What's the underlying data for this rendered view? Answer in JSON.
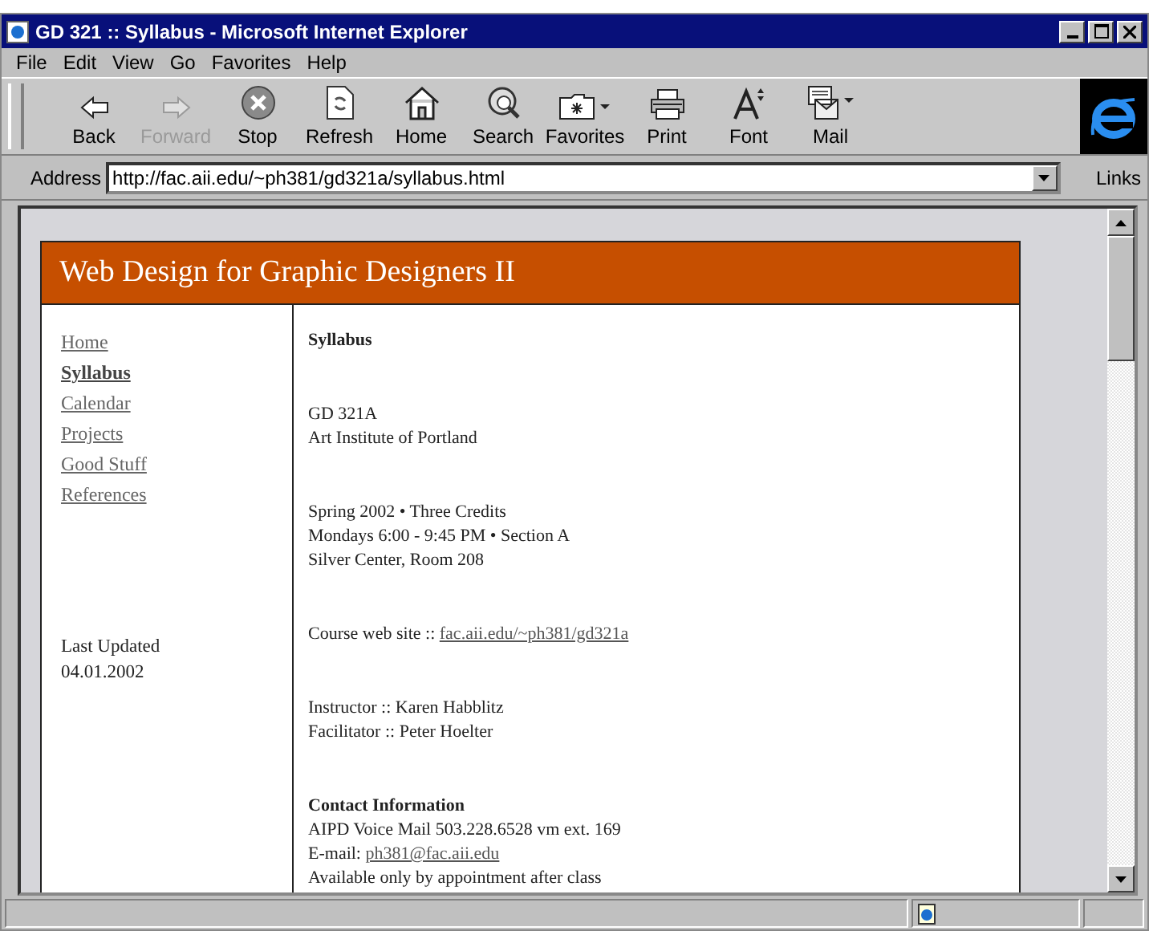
{
  "window": {
    "title": "GD 321 :: Syllabus - Microsoft Internet Explorer"
  },
  "menu": [
    "File",
    "Edit",
    "View",
    "Go",
    "Favorites",
    "Help"
  ],
  "toolbar": [
    {
      "kind": "back",
      "label": "Back",
      "disabled": false
    },
    {
      "kind": "forward",
      "label": "Forward",
      "disabled": true
    },
    {
      "kind": "stop",
      "label": "Stop",
      "disabled": false
    },
    {
      "kind": "refresh",
      "label": "Refresh",
      "disabled": false
    },
    {
      "kind": "home",
      "label": "Home",
      "disabled": false
    },
    {
      "kind": "search",
      "label": "Search",
      "disabled": false
    },
    {
      "kind": "favorites",
      "label": "Favorites",
      "disabled": false
    },
    {
      "kind": "print",
      "label": "Print",
      "disabled": false
    },
    {
      "kind": "font",
      "label": "Font",
      "disabled": false
    },
    {
      "kind": "mail",
      "label": "Mail",
      "disabled": false
    }
  ],
  "address": {
    "label": "Address",
    "value": "http://fac.aii.edu/~ph381/gd321a/syllabus.html"
  },
  "links": "Links",
  "page": {
    "heading": "Web Design for Graphic Designers II",
    "nav": [
      {
        "label": "Home",
        "selected": false
      },
      {
        "label": "Syllabus",
        "selected": true
      },
      {
        "label": "Calendar",
        "selected": false
      },
      {
        "label": "Projects",
        "selected": false
      },
      {
        "label": "Good Stuff",
        "selected": false
      },
      {
        "label": "References",
        "selected": false
      }
    ],
    "updated": [
      "Last Updated",
      "04.01.2002"
    ],
    "sections": [
      {
        "lines": [
          {
            "kind": "heading",
            "text": "Syllabus"
          }
        ]
      },
      {
        "lines": [
          {
            "kind": "text",
            "text": "GD 321A"
          },
          {
            "kind": "text",
            "text": "Art Institute of Portland"
          }
        ]
      },
      {
        "lines": [
          {
            "kind": "text",
            "text": "Spring 2002 • Three Credits"
          },
          {
            "kind": "text",
            "text": "Mondays 6:00 - 9:45 PM • Section A"
          },
          {
            "kind": "text",
            "text": "Silver Center, Room 208"
          }
        ]
      },
      {
        "lines": [
          {
            "kind": "link",
            "text": "Course web site :: ",
            "link": "fac.aii.edu/~ph381/gd321a"
          }
        ]
      },
      {
        "lines": [
          {
            "kind": "text",
            "text": "Instructor :: Karen Habblitz"
          },
          {
            "kind": "text",
            "text": "Facilitator :: Peter Hoelter"
          }
        ]
      },
      {
        "lines": [
          {
            "kind": "heading",
            "text": "Contact Information"
          },
          {
            "kind": "text",
            "text": "AIPD Voice Mail 503.228.6528 vm ext. 169"
          },
          {
            "kind": "link",
            "text": "E-mail: ",
            "link": "ph381@fac.aii.edu"
          },
          {
            "kind": "text",
            "text": "Available only by appointment after class"
          }
        ]
      }
    ]
  }
}
